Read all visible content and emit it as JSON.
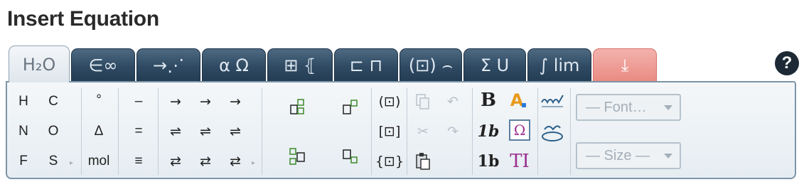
{
  "page": {
    "title": "Insert Equation"
  },
  "tabs": [
    {
      "label": "H₂O",
      "glyph": "",
      "active": true
    },
    {
      "label": "∈∞"
    },
    {
      "label": "→⋰"
    },
    {
      "label": "α Ω"
    },
    {
      "label": "⊞ ⦃"
    },
    {
      "label": "⊏ ⊓"
    },
    {
      "label": "(⊡) ⌢"
    },
    {
      "label": "Σ U"
    },
    {
      "label": "∫ lim"
    },
    {
      "label": "⤓"
    }
  ],
  "help": {
    "label": "?"
  },
  "panel": {
    "elements": [
      "H",
      "C",
      "N",
      "O",
      "F",
      "S"
    ],
    "ops_col1": [
      "°",
      "Δ",
      "mol"
    ],
    "ops_col2": [
      "–",
      "=",
      "≡"
    ],
    "arrows": [
      "→",
      "→",
      "→",
      "⇌",
      "⇌",
      "⇌",
      "⇄",
      "⇄",
      "⇄"
    ],
    "brackets": [
      "(⊡)",
      "[⊡]",
      "{⊡}"
    ],
    "format_b": "B",
    "format_1b_italic": "1b",
    "format_1b_bold": "1b",
    "font_color_glyph": "A",
    "omega_glyph": "Ω",
    "textline_glyph": "TI",
    "font_dropdown": "— Font…",
    "size_dropdown": "— Size —"
  },
  "colors": {
    "tab_bg": "#2f4a62",
    "tab_active_bg": "#e8eef3",
    "tab_red": "#ea8b83",
    "panel_border": "#7d95a8",
    "accent_green": "#3a8a2a"
  }
}
